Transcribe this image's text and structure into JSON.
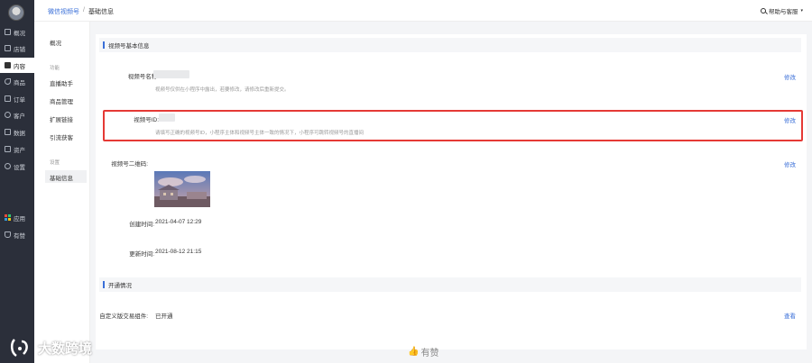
{
  "sidebar": {
    "items": [
      {
        "label": "概况"
      },
      {
        "label": "店铺"
      },
      {
        "label": "内容"
      },
      {
        "label": "商品"
      },
      {
        "label": "订单"
      },
      {
        "label": "客户"
      },
      {
        "label": "数据"
      },
      {
        "label": "资产"
      },
      {
        "label": "设置"
      }
    ],
    "apps_label": "应用",
    "fav_label": "有赞"
  },
  "submenu": {
    "overview": "概况",
    "group_function": "功能",
    "items": [
      "直播助手",
      "商品管理",
      "扩展链接",
      "引流获客"
    ],
    "group_settings": "设置",
    "basic_info": "基础信息"
  },
  "topbar": {
    "crumb_link": "微信视频号",
    "crumb_sep": "/",
    "crumb_current": "基础信息",
    "help": "帮助与客服"
  },
  "section1": {
    "title": "视频号基本信息",
    "name_label": "视频号名称:",
    "name_hint": "视频号仅供在小程序中露出，若要修改，请修改后重新提交。",
    "id_label": "视频号ID:",
    "id_hint": "请填写正确的视频号ID，小程序主体和视频号主体一致的情况下，小程序可跳转视频号的直播间",
    "qr_label": "视频号二维码:",
    "created_label": "创建时间:",
    "created_value": "2021-04-07 12:29",
    "updated_label": "更新时间:",
    "updated_value": "2021-08-12 21:15",
    "edit_label": "修改"
  },
  "section2": {
    "title": "开通情况",
    "component_label": "自定义版交易组件:",
    "component_value": "已开通",
    "view_label": "查看"
  },
  "watermark": {
    "text": "大数跨境"
  },
  "footer": {
    "like": "有赞"
  },
  "colors": {
    "accent": "#3a6fd8",
    "highlight": "#e53935",
    "sidebar": "#2b2f3a"
  }
}
